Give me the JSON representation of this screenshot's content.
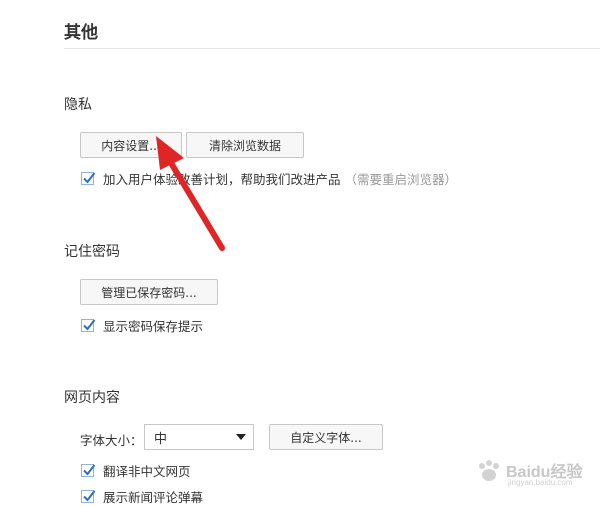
{
  "page": {
    "title": "其他"
  },
  "privacy": {
    "title": "隐私",
    "content_settings_button": "内容设置...",
    "clear_data_button": "清除浏览数据",
    "improvement_checkbox": {
      "label": "加入用户体验改善计划，帮助我们改进产品",
      "hint": "（需要重启浏览器）",
      "checked": true
    }
  },
  "passwords": {
    "title": "记住密码",
    "manage_button": "管理已保存密码...",
    "show_prompt_checkbox": {
      "label": "显示密码保存提示",
      "checked": true
    }
  },
  "web_content": {
    "title": "网页内容",
    "font_size_label": "字体大小：",
    "font_size_value": "中",
    "custom_font_button": "自定义字体...",
    "translate_checkbox": {
      "label": "翻译非中文网页",
      "checked": true
    },
    "news_checkbox": {
      "label": "展示新闻评论弹幕",
      "checked": true
    }
  },
  "watermark": {
    "text": "Baidu经验",
    "sub_text": "jingyan.baidu.com"
  },
  "colors": {
    "arrow": "#e02525",
    "check": "#2b6fc6"
  }
}
